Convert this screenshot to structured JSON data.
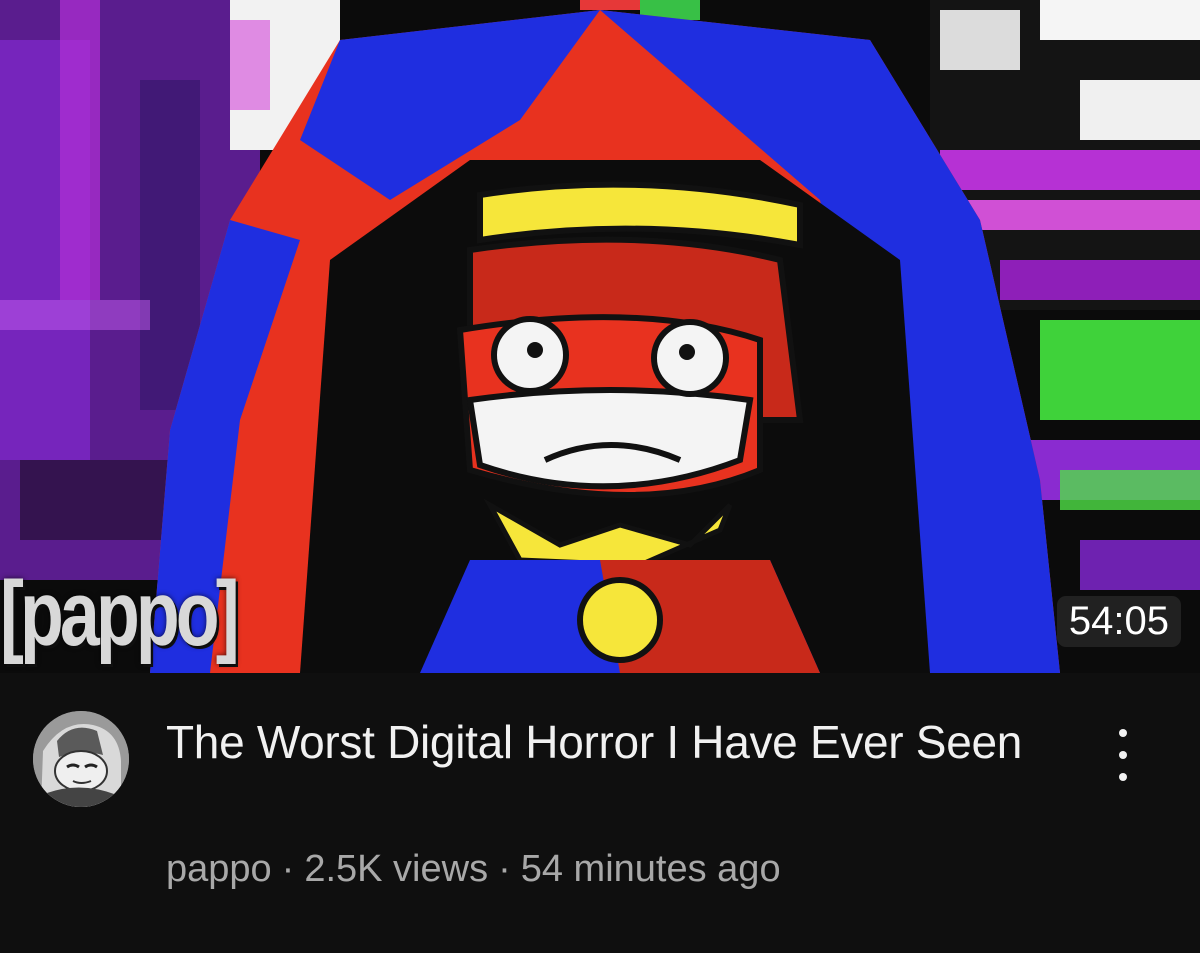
{
  "video": {
    "title": "The Worst Digital Horror I Have Ever Seen",
    "duration": "54:05",
    "thumbnail_watermark": "[pappo]",
    "channel": "pappo",
    "views": "2.5K views",
    "published": "54 minutes ago",
    "separator": "·"
  },
  "icons": {
    "menu": "more-vert-icon",
    "avatar": "channel-avatar"
  },
  "colors": {
    "background": "#0f0f0f",
    "title_text": "#f1f1f1",
    "meta_text": "#a8a8a8",
    "thumb_red": "#e8321f",
    "thumb_blue": "#1f2ee0",
    "thumb_yellow": "#f6e63a",
    "thumb_purple": "#9a2bd6"
  }
}
